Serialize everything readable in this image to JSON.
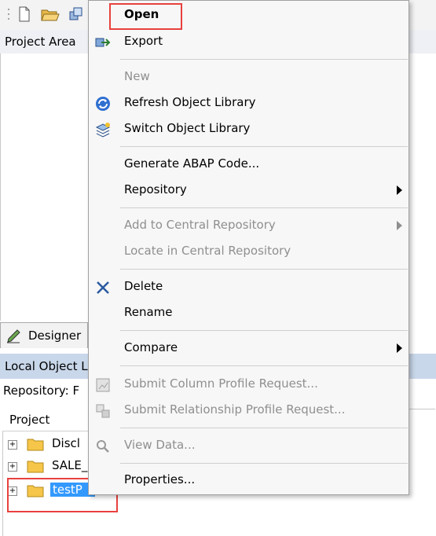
{
  "background": {
    "panel_title": "Project Area",
    "designer_tab": "Designer",
    "local_object_library": "Local Object L",
    "repository_label": "Repository: F",
    "tree_column_header": "Project",
    "tree_items": [
      {
        "label": "Discl",
        "selected": false
      },
      {
        "label": "SALE_",
        "selected": false
      },
      {
        "label": "testP",
        "selected": true
      }
    ]
  },
  "context_menu": {
    "items": [
      {
        "label": "Open",
        "disabled": false,
        "icon": null,
        "bold": true,
        "submenu": false
      },
      {
        "label": "Export",
        "disabled": false,
        "icon": "export-icon",
        "submenu": false
      },
      {
        "label": "New",
        "disabled": true,
        "icon": null,
        "submenu": false
      },
      {
        "label": "Refresh Object Library",
        "disabled": false,
        "icon": "refresh-icon",
        "submenu": false
      },
      {
        "label": "Switch Object Library",
        "disabled": false,
        "icon": "switch-library-icon",
        "submenu": false
      },
      {
        "label": "Generate ABAP Code...",
        "disabled": false,
        "icon": null,
        "submenu": false
      },
      {
        "label": "Repository",
        "disabled": false,
        "icon": null,
        "submenu": true
      },
      {
        "label": "Add to Central Repository",
        "disabled": true,
        "icon": null,
        "submenu": true
      },
      {
        "label": "Locate in Central Repository",
        "disabled": true,
        "icon": null,
        "submenu": false
      },
      {
        "label": "Delete",
        "disabled": false,
        "icon": "delete-icon",
        "submenu": false
      },
      {
        "label": "Rename",
        "disabled": false,
        "icon": null,
        "submenu": false
      },
      {
        "label": "Compare",
        "disabled": false,
        "icon": null,
        "submenu": true
      },
      {
        "label": "Submit Column Profile Request...",
        "disabled": true,
        "icon": "column-profile-icon",
        "submenu": false
      },
      {
        "label": "Submit Relationship Profile Request...",
        "disabled": true,
        "icon": "relationship-profile-icon",
        "submenu": false
      },
      {
        "label": "View Data...",
        "disabled": true,
        "icon": "view-data-icon",
        "submenu": false
      },
      {
        "label": "Properties...",
        "disabled": false,
        "icon": null,
        "submenu": false
      }
    ]
  },
  "colors": {
    "highlight_box": "#e8413e",
    "selection": "#3399ff",
    "disabled_text": "#8f8f8f"
  }
}
